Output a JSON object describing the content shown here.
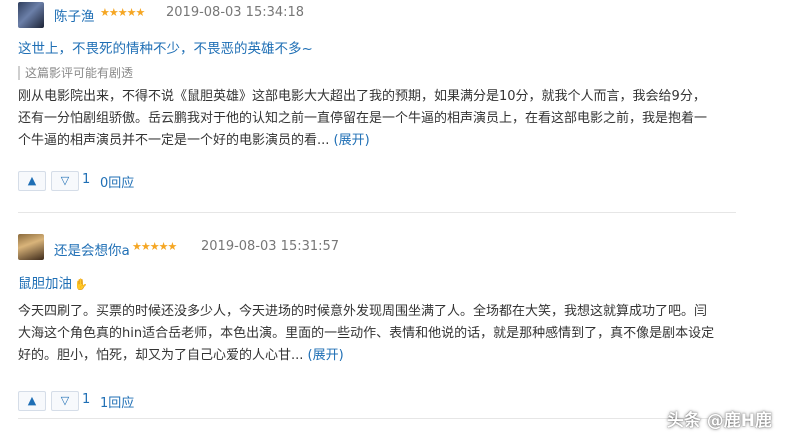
{
  "reviews": [
    {
      "username": "陈子渔",
      "stars": "★★★★★",
      "timestamp": "2019-08-03 15:34:18",
      "title": "这世上，不畏死的情种不少，不畏恶的英雄不多~",
      "spoiler_notice": "这篇影评可能有剧透",
      "body": "刚从电影院出来，不得不说《鼠胆英雄》这部电影大大超出了我的预期，如果满分是10分，就我个人而言，我会给9分，还有一分怕剧组骄傲。岳云鹏我对于他的认知之前一直停留在是一个牛逼的相声演员上，在看这部电影之前，我是抱着一个牛逼的相声演员并不一定是一个好的电影演员的看...",
      "expand_label": "(展开)",
      "down_count": "1",
      "reply_label": "0回应"
    },
    {
      "username": "还是会想你a",
      "stars": "★★★★★",
      "timestamp": "2019-08-03 15:31:57",
      "title": "鼠胆加油",
      "body": "今天四刷了。买票的时候还没多少人，今天进场的时候意外发现周围坐满了人。全场都在大笑，我想这就算成功了吧。闫大海这个角色真的hin适合岳老师，本色出演。里面的一些动作、表情和他说的话，就是那种感情到了，真不像是剧本设定好的。胆小，怕死，却又为了自己心爱的人心甘...",
      "expand_label": "(展开)",
      "down_count": "1",
      "reply_label": "1回应"
    }
  ],
  "icons": {
    "up": "▲",
    "down": "▽",
    "hand": "✋"
  },
  "watermark": "头条 @鹿H鹿",
  "colors": {
    "link": "#1f6fb5",
    "star": "#f5a623",
    "text": "#333333",
    "muted": "#777777"
  }
}
